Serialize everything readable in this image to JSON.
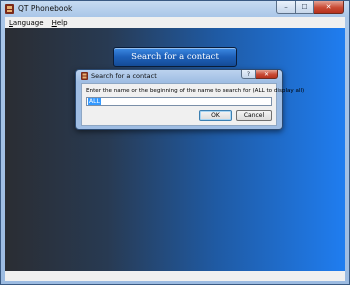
{
  "window": {
    "title": "QT Phonebook",
    "min_glyph": "–",
    "max_glyph": "☐",
    "close_glyph": "✕"
  },
  "menubar": {
    "items": [
      {
        "mnemonic": "L",
        "rest": "anguage"
      },
      {
        "mnemonic": "H",
        "rest": "elp"
      }
    ]
  },
  "main": {
    "search_button_label": "Search for a contact"
  },
  "dialog": {
    "title": "Search for a contact",
    "help_glyph": "?",
    "close_glyph": "✕",
    "prompt": "Enter the name or the beginning of the name to search for (ALL to display all)",
    "input_value": "ALL",
    "ok_label": "OK",
    "cancel_label": "Cancel"
  },
  "colors": {
    "gradient_left": "#2a2d33",
    "gradient_right": "#1f7df0",
    "close_red": "#c94a34"
  },
  "icons": [
    "app-icon",
    "minimize-icon",
    "maximize-icon",
    "close-icon",
    "help-icon"
  ]
}
